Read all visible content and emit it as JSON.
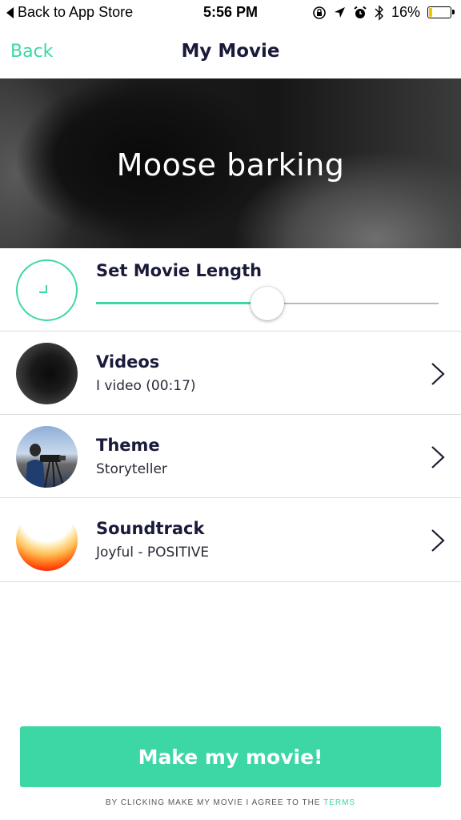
{
  "status_bar": {
    "back_label": "Back to App Store",
    "time": "5:56 PM",
    "battery_percent": "16%",
    "battery_level": 0.16,
    "battery_color": "#f5c400"
  },
  "nav": {
    "back_label": "Back",
    "title": "My Movie"
  },
  "hero": {
    "title": "Moose barking"
  },
  "movie_length": {
    "title": "Set Movie Length",
    "slider_value": 0.5,
    "icon": "clock-icon"
  },
  "rows": [
    {
      "title": "Videos",
      "subtitle": "I video (00:17)",
      "icon": "chevron-right-icon"
    },
    {
      "title": "Theme",
      "subtitle": "Storyteller",
      "icon": "chevron-right-icon"
    },
    {
      "title": "Soundtrack",
      "subtitle": "Joyful - POSITIVE",
      "icon": "chevron-right-icon"
    }
  ],
  "cta": {
    "label": "Make my movie!"
  },
  "terms": {
    "prefix": "BY CLICKING MAKE MY MOVIE I AGREE TO THE",
    "link": "TERMS"
  },
  "colors": {
    "accent": "#3dd6a5",
    "title_text": "#1a1a3a"
  }
}
